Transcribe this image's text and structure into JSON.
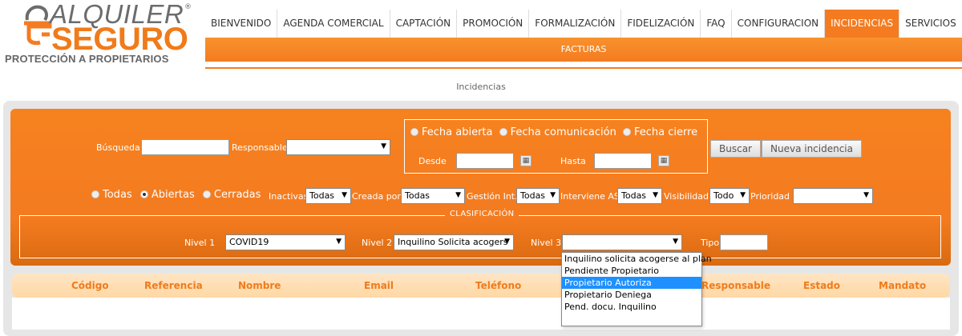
{
  "brand": {
    "name_top": "ALQUILER",
    "name_bottom": "SEGURO",
    "registered": "®",
    "tagline": "PROTECCIÓN A PROPIETARIOS",
    "color_orange": "#f47b20",
    "color_gray": "#6c6c6c"
  },
  "nav": {
    "items": [
      "BIENVENIDO",
      "AGENDA COMERCIAL",
      "CAPTACIÓN",
      "PROMOCIÓN",
      "FORMALIZACIÓN",
      "FIDELIZACIÓN",
      "FAQ",
      "CONFIGURACION",
      "INCIDENCIAS",
      "SERVICIOS"
    ],
    "active": "INCIDENCIAS",
    "sub": "FACTURAS"
  },
  "page": {
    "title": "Incidencias"
  },
  "filters": {
    "busqueda_label": "Búsqueda",
    "busqueda_value": "",
    "responsable_label": "Responsable",
    "responsable_value": "",
    "date_radio_1": "Fecha abierta",
    "date_radio_2": "Fecha comunicación",
    "date_radio_3": "Fecha cierre",
    "desde_label": "Desde",
    "hasta_label": "Hasta",
    "buscar_button": "Buscar",
    "nueva_button": "Nueva incidencia",
    "state_radio_1": "Todas",
    "state_radio_2": "Abiertas",
    "state_radio_3": "Cerradas",
    "inactivas_label": "Inactivas",
    "inactivas_value": "Todas",
    "creada_label": "Creada por",
    "creada_value": "Todas",
    "gestion_label": "Gestión Int.",
    "gestion_value": "Todas",
    "interviene_label": "Interviene AS",
    "interviene_value": "Todas",
    "visibilidad_label": "Visibilidad",
    "visibilidad_value": "Todo",
    "prioridad_label": "Prioridad",
    "prioridad_value": ""
  },
  "clasificacion": {
    "title": "CLASIFICACIÓN",
    "nivel1_label": "Nivel 1",
    "nivel1_value": "COVID19",
    "nivel2_label": "Nivel 2",
    "nivel2_value": "Inquilino Solicita acogers",
    "nivel3_label": "Nivel 3",
    "nivel3_value": "",
    "tipo_label": "Tipo",
    "tipo_value": ""
  },
  "nivel3_options": [
    "Inquilino solicita acogerse al plan",
    "Pendiente Propietario",
    "Propietario Autoriza",
    "Propietario Deniega",
    "Pend. docu. Inquilino"
  ],
  "nivel3_highlighted": "Propietario Autoriza",
  "table": {
    "columns": [
      "Código",
      "Referencia",
      "Nombre",
      "Email",
      "Teléfono",
      "Responsable",
      "Estado",
      "Mandato"
    ]
  }
}
